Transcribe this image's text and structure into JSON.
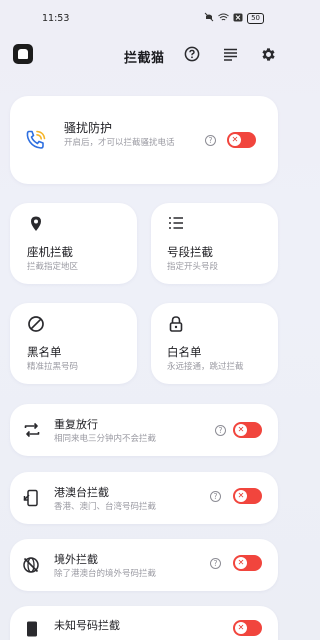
{
  "status_bar": {
    "time": "11:53",
    "battery": "50"
  },
  "app_bar": {
    "title": "拦截猫",
    "icons": [
      "app-logo",
      "help-circle-icon",
      "menu-lines-icon",
      "settings-gear-icon"
    ]
  },
  "harassment": {
    "title": "骚扰防护",
    "desc": "开启后，才可以拦截骚扰电话",
    "enabled": false
  },
  "grid": [
    {
      "title": "座机拦截",
      "desc": "拦截指定地区",
      "icon": "location-pin-icon"
    },
    {
      "title": "号段拦截",
      "desc": "指定开头号段",
      "icon": "list-icon"
    },
    {
      "title": "黑名单",
      "desc": "精准拉黑号码",
      "icon": "block-icon"
    },
    {
      "title": "白名单",
      "desc": "永远接通，跳过拦截",
      "icon": "lock-icon"
    }
  ],
  "rows": [
    {
      "title": "重复放行",
      "desc": "相同来电三分钟内不会拦截",
      "icon": "repeat-icon",
      "enabled": false
    },
    {
      "title": "港澳台拦截",
      "desc": "香港、澳门、台湾号码拦截",
      "icon": "phone-exit-icon",
      "enabled": false
    },
    {
      "title": "境外拦截",
      "desc": "除了港澳台的境外号码拦截",
      "icon": "globe-off-icon",
      "enabled": false
    },
    {
      "title": "未知号码拦截",
      "desc": "",
      "icon": "unknown-phone-icon",
      "enabled": false
    }
  ],
  "colors": {
    "accent_red": "#f1453d",
    "background": "#eeeef6",
    "card": "#ffffff"
  }
}
